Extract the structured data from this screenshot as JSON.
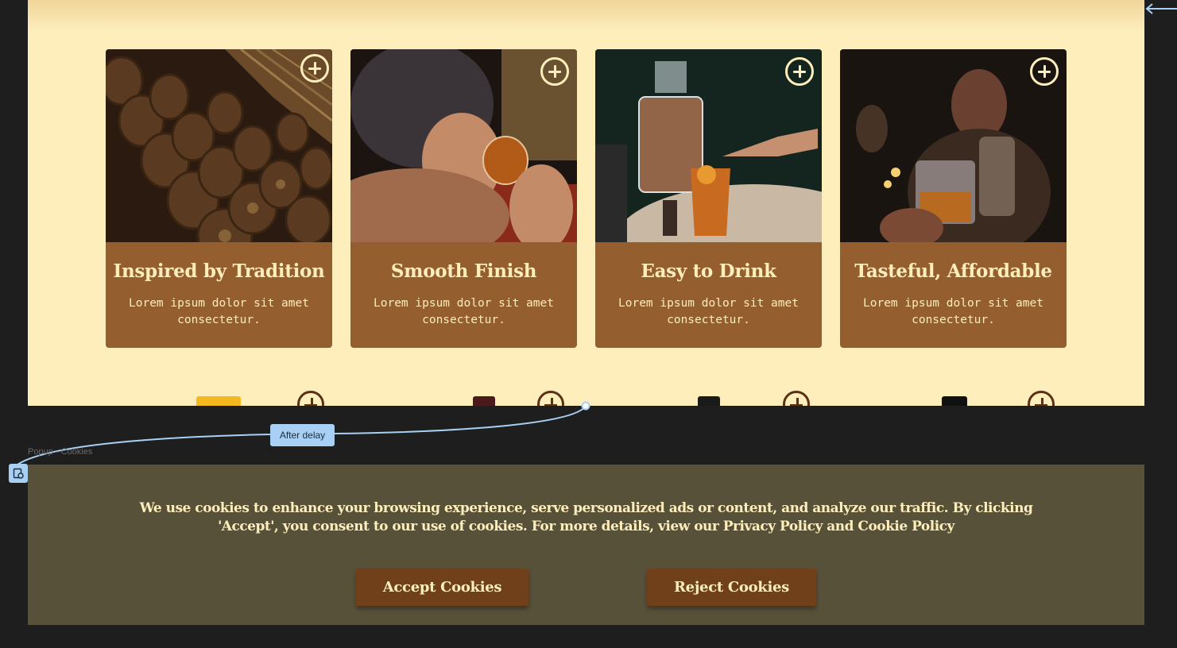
{
  "features": {
    "cards": [
      {
        "title": "Inspired by Tradition",
        "text": "Lorem ipsum dolor sit amet consectetur.",
        "photo": "whiskey-barrels"
      },
      {
        "title": "Smooth Finish",
        "text": "Lorem ipsum dolor sit amet consectetur.",
        "photo": "man-drinking-whiskey"
      },
      {
        "title": "Easy to Drink",
        "text": "Lorem ipsum dolor sit amet consectetur.",
        "photo": "decanter-cocktail"
      },
      {
        "title": "Tasteful, Affordable",
        "text": "Lorem ipsum dolor sit amet consectetur.",
        "photo": "glass-toast"
      }
    ],
    "add_icon": "plus-circle-icon"
  },
  "prototype": {
    "trigger_label": "After delay",
    "frame_label": "Popup - Cookies",
    "badge_icon": "overlay-frame-icon"
  },
  "cookie_popup": {
    "message": "We use cookies to enhance your browsing experience, serve personalized ads or content, and analyze our traffic. By clicking 'Accept',  you consent to our use of cookies. For more details, view our Privacy Policy and Cookie Policy",
    "accept_label": "Accept Cookies",
    "reject_label": "Reject Cookies"
  },
  "colors": {
    "page_cream": "#fdeebc",
    "card_brown": "#955e2e",
    "popup_olive": "#58513a",
    "button_brown": "#70401b",
    "prototype_blue": "#a8d0f5"
  }
}
